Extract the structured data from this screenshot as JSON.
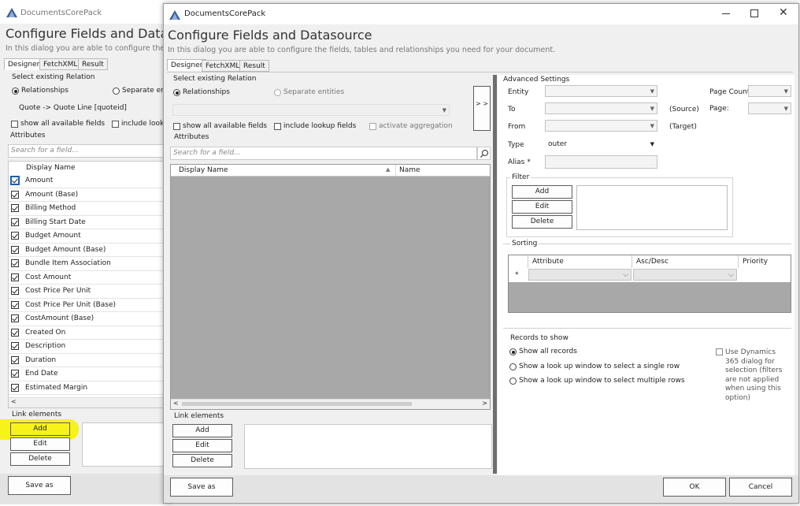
{
  "back_window": {
    "app_title": "DocumentsCorePack",
    "dialog_title": "Configure Fields and Datasou",
    "subtitle": "In this dialog you are able to configure the",
    "tabs": [
      "Designer",
      "FetchXML",
      "Result"
    ],
    "select_relation_label": "Select existing Relation",
    "radio_relationships": "Relationships",
    "radio_separate": "Separate enti",
    "relation_value": "Quote -> Quote Line   [quoteid]",
    "show_all_fields": "show all available fields",
    "include_lookup": "include looku",
    "attributes_label": "Attributes",
    "search_placeholder": "Search for a field...",
    "col_display_name": "Display Name",
    "rows": [
      "Amount",
      "Amount (Base)",
      "Billing Method",
      "Billing Start Date",
      "Budget Amount",
      "Budget Amount (Base)",
      "Bundle Item Association",
      "Cost Amount",
      "Cost Price Per Unit",
      "Cost Price Per Unit (Base)",
      "CostAmount (Base)",
      "Created On",
      "Description",
      "Duration",
      "End Date",
      "Estimated Margin"
    ],
    "link_elements_label": "Link elements",
    "add_label": "Add",
    "edit_label": "Edit",
    "delete_label": "Delete",
    "save_as_label": "Save as"
  },
  "front_window": {
    "app_title": "DocumentsCorePack",
    "dialog_title": "Configure Fields and Datasource",
    "subtitle": "In this dialog you are able to configure the fields, tables and relationships you need for your document.",
    "tabs": [
      "Designer",
      "FetchXML",
      "Result"
    ],
    "select_relation_label": "Select existing Relation",
    "radio_relationships": "Relationships",
    "radio_separate": "Separate entities",
    "show_all_fields": "show all available fields",
    "include_lookup": "include lookup fields",
    "activate_aggregation": "activate aggregation",
    "attributes_label": "Attributes",
    "search_placeholder": "Search for a field...",
    "col_display_name": "Display Name",
    "col_name": "Name",
    "expand_btn": "> >",
    "link_elements_label": "Link elements",
    "add_label": "Add",
    "edit_label": "Edit",
    "delete_label": "Delete",
    "save_as_label": "Save as",
    "ok_label": "OK",
    "cancel_label": "Cancel",
    "advanced": {
      "title": "Advanced Settings",
      "entity": "Entity",
      "to": "To",
      "from": "From",
      "type": "Type",
      "type_value": "outer",
      "alias": "Alias *",
      "source": "(Source)",
      "target": "(Target)",
      "page_count": "Page Count:",
      "page": "Page:",
      "filter_title": "Filter",
      "sorting_title": "Sorting",
      "col_attribute": "Attribute",
      "col_ascdesc": "Asc/Desc",
      "col_priority": "Priority",
      "row_marker": "*",
      "records_title": "Records to show",
      "show_all": "Show all records",
      "single_row": "Show a look up window to select a single row",
      "multiple_rows": "Show a look up window to select multiple rows",
      "dynamics_opt": "Use Dynamics 365 dialog for selection (filters are not applied when using this option)"
    }
  },
  "colors": {
    "highlight": "#f7f31a",
    "grid_gray": "#a8a8a8",
    "accent": "#1f5fb8"
  }
}
